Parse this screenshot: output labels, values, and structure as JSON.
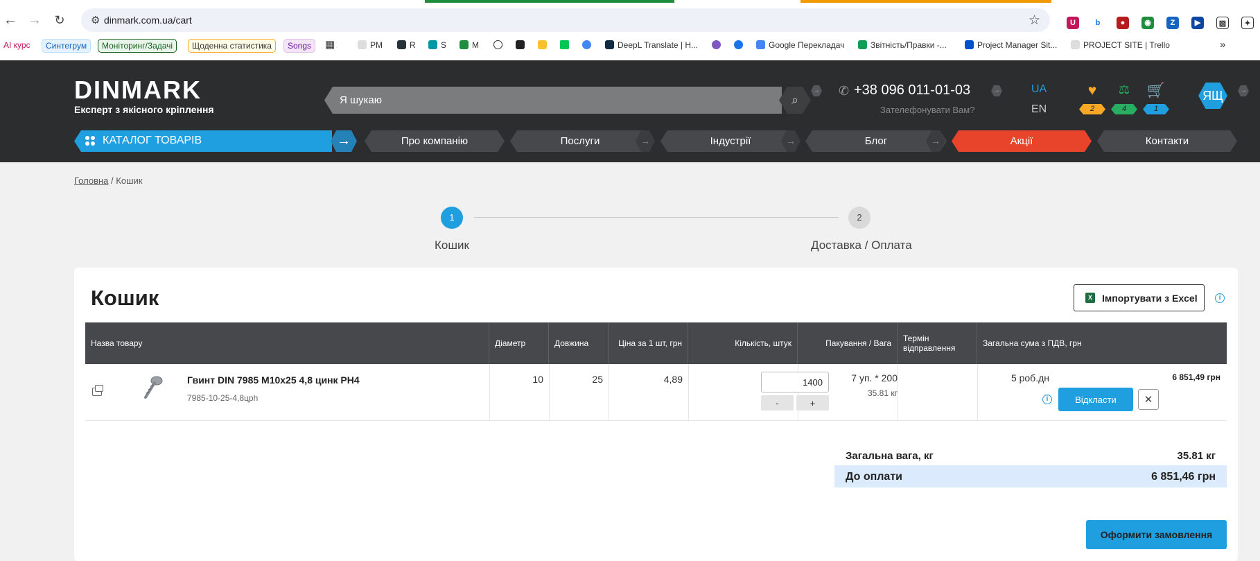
{
  "browser": {
    "url": "dinmark.com.ua/cart",
    "bookmarks": [
      {
        "label": "AI курс"
      },
      {
        "label": "Синтегрум"
      },
      {
        "label": "Моніторинг/Задачі"
      },
      {
        "label": "Щоденна статистика"
      },
      {
        "label": "Songs"
      },
      {
        "label": "PM"
      },
      {
        "label": "R"
      },
      {
        "label": "S"
      },
      {
        "label": "M"
      },
      {
        "label": "DeepL Translate | H..."
      },
      {
        "label": "Google Перекладач"
      },
      {
        "label": "Звітність/Правки -..."
      },
      {
        "label": "Project Manager Sit..."
      },
      {
        "label": "PROJECT SITE | Trello"
      }
    ]
  },
  "header": {
    "logo_word": "DINMARK",
    "logo_tagline": "Експерт з якісного кріплення",
    "search_placeholder": "Я шукаю",
    "phone": "+38 096 011-01-03",
    "callback": "Зателефонувати Вам?",
    "lang_active": "UA",
    "lang_other": "EN",
    "favorites_count": "2",
    "compare_count": "4",
    "cart_count": "1",
    "avatar_initials": "ЯЩ",
    "catalog_label": "КАТАЛОГ ТОВАРІВ",
    "nav": [
      "Про компанію",
      "Послуги",
      "Індустрії",
      "Блог",
      "Акції",
      "Контакти"
    ]
  },
  "breadcrumb": {
    "home": "Головна",
    "sep": "/",
    "current": "Кошик"
  },
  "steps": [
    {
      "num": "1",
      "label": "Кошик"
    },
    {
      "num": "2",
      "label": "Доставка / Оплата"
    }
  ],
  "cart": {
    "title": "Кошик",
    "import_label": "Імпортувати з Excel",
    "columns": [
      "Назва товару",
      "Діаметр",
      "Довжина",
      "Ціна за 1 шт, грн",
      "Кількість, штук",
      "Пакування / Вага",
      "Термін відправлення",
      "Загальна сума з ПДВ, грн"
    ],
    "item": {
      "name": "Гвинт DIN 7985 М10х25 4,8 цинк PH4",
      "sku": "7985-10-25-4,8цph",
      "diameter": "10",
      "length": "25",
      "price": "4,89",
      "quantity": "1400",
      "minus": "-",
      "plus": "+",
      "packing": "7 уп. * 200",
      "weight": "35.81 кг",
      "term": "5 роб.дн",
      "total": "6 851,49 грн",
      "defer_label": "Відкласти",
      "delete_label": "✕"
    },
    "summary": {
      "weight_label": "Загальна вага, кг",
      "weight_value": "35.81 кг",
      "pay_label": "До оплати",
      "pay_value": "6 851,46 грн"
    },
    "checkout_label": "Оформити замовлення"
  }
}
